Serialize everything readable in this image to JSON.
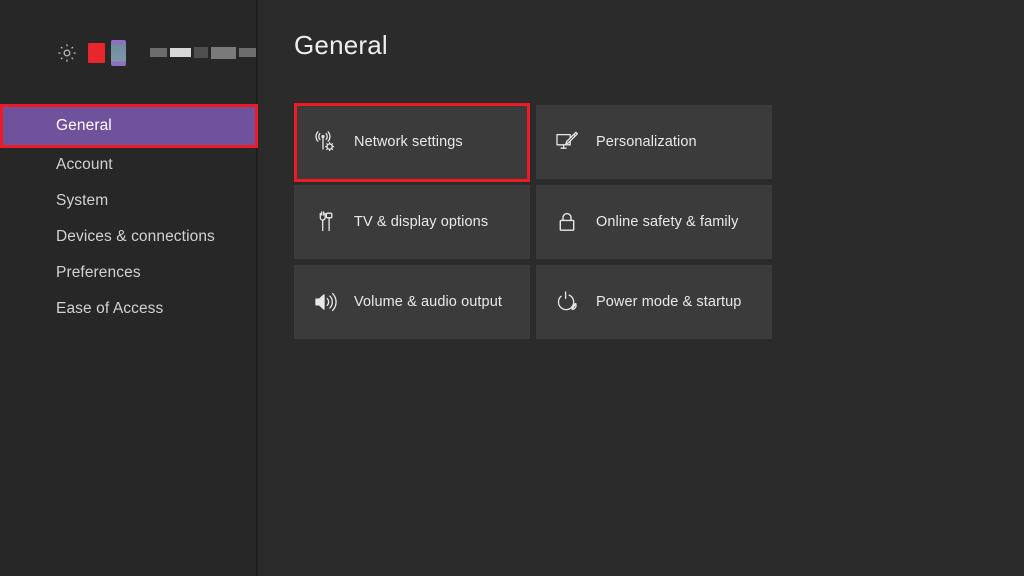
{
  "window": {
    "app": "Xbox Settings",
    "background_color": "#2b2b2b"
  },
  "sidebar": {
    "background_color": "#272727",
    "account_header": {
      "gear_icon": "gear-icon",
      "redacted_gamertag": "",
      "redacted_avatar": ""
    },
    "selected_index": 0,
    "selected_color": "#70519b",
    "items": [
      {
        "label": "General",
        "selected": true
      },
      {
        "label": "Account",
        "selected": false
      },
      {
        "label": "System",
        "selected": false
      },
      {
        "label": "Devices & connections",
        "selected": false
      },
      {
        "label": "Preferences",
        "selected": false
      },
      {
        "label": "Ease of Access",
        "selected": false
      }
    ]
  },
  "main": {
    "title": "General",
    "tiles": [
      {
        "label": "Network settings",
        "icon": "network-tower-gear-icon",
        "highlighted": true
      },
      {
        "label": "Personalization",
        "icon": "monitor-pen-icon",
        "highlighted": false
      },
      {
        "label": "TV & display options",
        "icon": "av-cable-icon",
        "highlighted": false
      },
      {
        "label": "Online safety & family",
        "icon": "lock-icon",
        "highlighted": false
      },
      {
        "label": "Volume & audio output",
        "icon": "speaker-waves-icon",
        "highlighted": false
      },
      {
        "label": "Power mode & startup",
        "icon": "power-leaf-icon",
        "highlighted": false
      }
    ]
  },
  "annotations": {
    "color": "#ee1b24",
    "boxes": [
      {
        "target": "sidebar-item-general"
      },
      {
        "target": "tile-network-settings"
      }
    ]
  }
}
